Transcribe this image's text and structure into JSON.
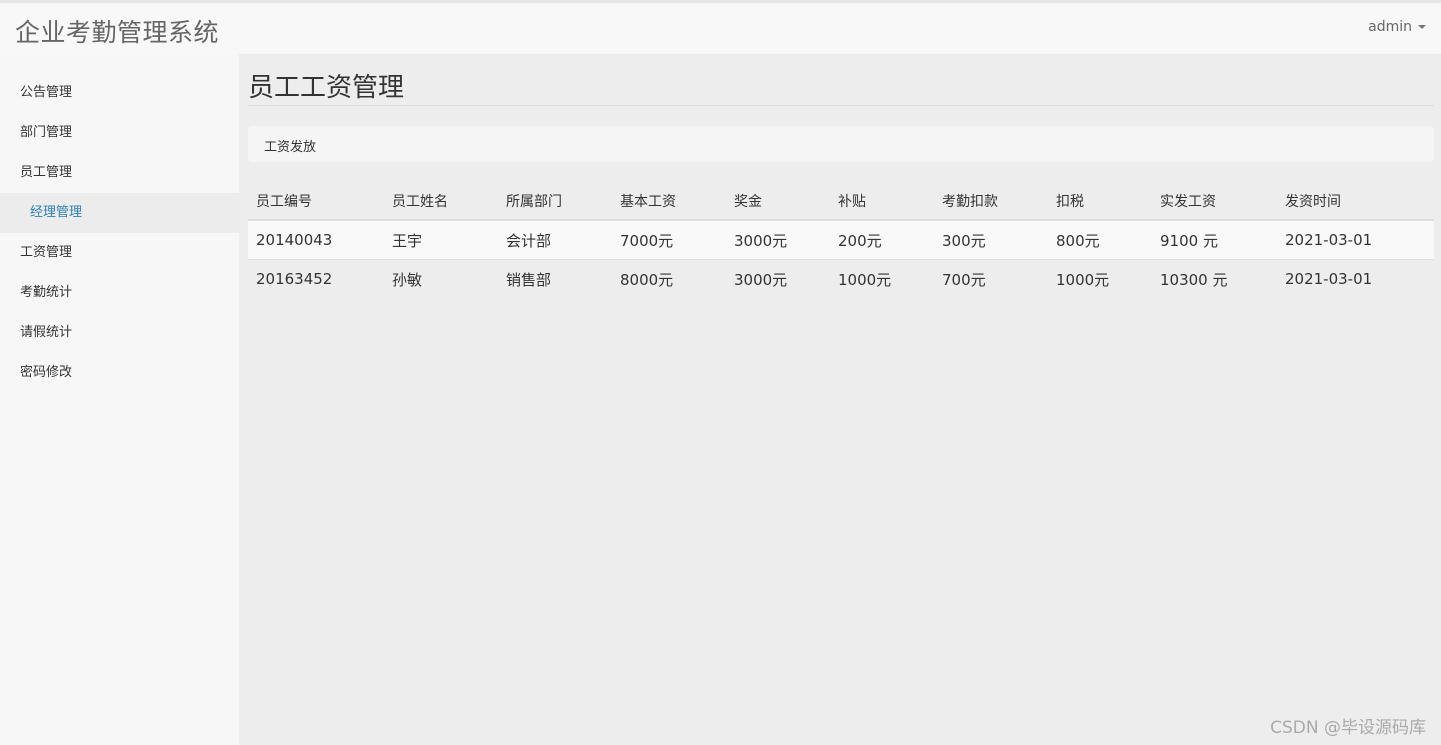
{
  "header": {
    "brand": "企业考勤管理系统",
    "user": "admin"
  },
  "sidebar": {
    "items": [
      {
        "label": "公告管理"
      },
      {
        "label": "部门管理"
      },
      {
        "label": "员工管理"
      },
      {
        "label": "经理管理"
      },
      {
        "label": "工资管理"
      },
      {
        "label": "考勤统计"
      },
      {
        "label": "请假统计"
      },
      {
        "label": "密码修改"
      }
    ]
  },
  "main": {
    "title": "员工工资管理",
    "breadcrumb": "工资发放",
    "table": {
      "headers": [
        "员工编号",
        "员工姓名",
        "所属部门",
        "基本工资",
        "奖金",
        "补贴",
        "考勤扣款",
        "扣税",
        "实发工资",
        "发资时间"
      ],
      "rows": [
        [
          "20140043",
          "王宇",
          "会计部",
          "7000元",
          "3000元",
          "200元",
          "300元",
          "800元",
          "9100 元",
          "2021-03-01"
        ],
        [
          "20163452",
          "孙敏",
          "销售部",
          "8000元",
          "3000元",
          "1000元",
          "700元",
          "1000元",
          "10300 元",
          "2021-03-01"
        ]
      ]
    }
  },
  "watermark": "CSDN @毕设源码库"
}
